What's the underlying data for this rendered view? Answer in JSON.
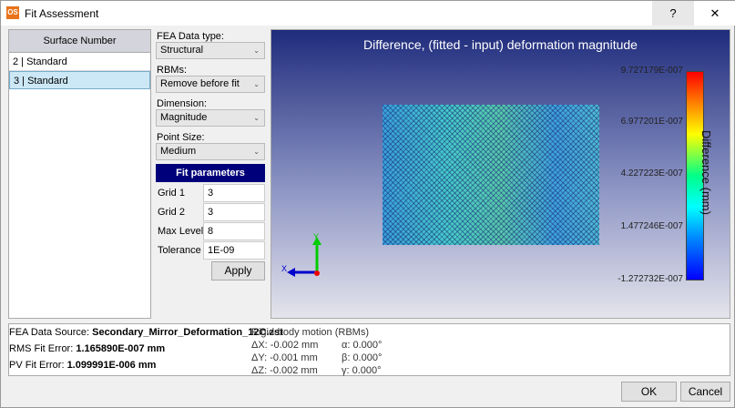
{
  "window": {
    "title": "Fit Assessment",
    "logo": "OS",
    "help": "?",
    "close": "✕"
  },
  "surface_list": {
    "header": "Surface Number",
    "items": [
      {
        "label": "2 | Standard",
        "selected": false
      },
      {
        "label": "3 | Standard",
        "selected": true
      }
    ]
  },
  "controls": {
    "fea_type": {
      "label": "FEA Data type:",
      "value": "Structural"
    },
    "rbms": {
      "label": "RBMs:",
      "value": "Remove before fit"
    },
    "dimension": {
      "label": "Dimension:",
      "value": "Magnitude"
    },
    "point_size": {
      "label": "Point Size:",
      "value": "Medium"
    },
    "fit_header": "Fit parameters",
    "params": [
      {
        "label": "Grid 1",
        "value": "3"
      },
      {
        "label": "Grid 2",
        "value": "3"
      },
      {
        "label": "Max Level",
        "value": "8"
      },
      {
        "label": "Tolerance",
        "value": "1E-09"
      }
    ],
    "apply": "Apply"
  },
  "plot": {
    "title": "Difference, (fitted - input) deformation magnitude",
    "colorbar_label": "Difference (mm)",
    "ticks": [
      "9.727179E-007",
      "6.977201E-007",
      "4.227223E-007",
      "1.477246E-007",
      "-1.272732E-007"
    ],
    "axis_x": "X",
    "axis_y": "Y"
  },
  "info": {
    "source_label": "FEA Data Source: ",
    "source": "Secondary_Mirror_Deformation_12C.zst",
    "rms_label": "RMS Fit Error: ",
    "rms": "1.165890E-007 mm",
    "pv_label": "PV Fit Error: ",
    "pv": "1.099991E-006 mm",
    "rbm_title": "Rigid-body motion (RBMs)",
    "dx": "ΔX: -0.002 mm",
    "dy": "ΔY: -0.001 mm",
    "dz": "ΔZ: -0.002 mm",
    "a": "α: 0.000°",
    "b": "β: 0.000°",
    "g": "γ: 0.000°"
  },
  "buttons": {
    "ok": "OK",
    "cancel": "Cancel"
  }
}
